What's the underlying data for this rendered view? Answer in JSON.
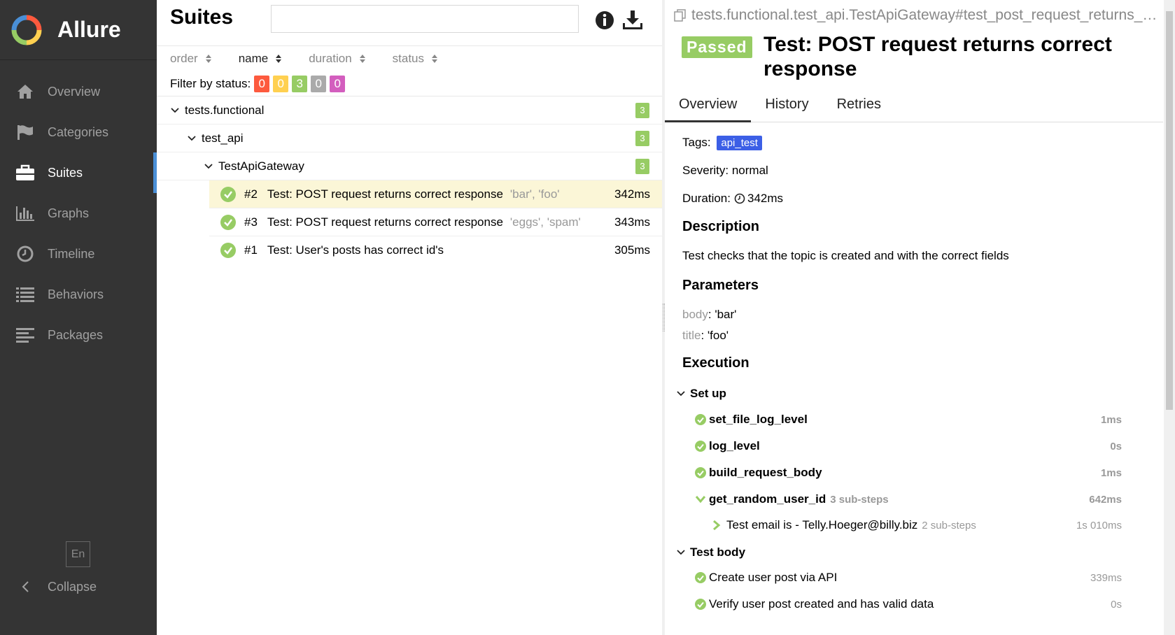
{
  "brand": {
    "name": "Allure"
  },
  "sidebar": {
    "items": [
      {
        "label": "Overview",
        "icon": "home-icon"
      },
      {
        "label": "Categories",
        "icon": "flag-icon"
      },
      {
        "label": "Suites",
        "icon": "briefcase-icon",
        "active": true
      },
      {
        "label": "Graphs",
        "icon": "bar-chart-icon"
      },
      {
        "label": "Timeline",
        "icon": "clock-icon"
      },
      {
        "label": "Behaviors",
        "icon": "list-icon"
      },
      {
        "label": "Packages",
        "icon": "align-left-icon"
      }
    ],
    "language": "En",
    "collapse_label": "Collapse"
  },
  "suites": {
    "title": "Suites",
    "search_placeholder": "",
    "sort": [
      {
        "label": "order"
      },
      {
        "label": "name",
        "active": true
      },
      {
        "label": "duration"
      },
      {
        "label": "status"
      }
    ],
    "filter_label": "Filter by status:",
    "status_counts": [
      {
        "value": "0",
        "color": "#fd5a3e",
        "status": "failed"
      },
      {
        "value": "0",
        "color": "#ffd050",
        "status": "broken"
      },
      {
        "value": "3",
        "color": "#97cc64",
        "status": "passed"
      },
      {
        "value": "0",
        "color": "#aaaaaa",
        "status": "skipped"
      },
      {
        "value": "0",
        "color": "#d35ebe",
        "status": "unknown"
      }
    ],
    "tree": [
      {
        "label": "tests.functional",
        "count": "3"
      },
      {
        "label": "test_api",
        "count": "3"
      },
      {
        "label": "TestApiGateway",
        "count": "3"
      }
    ],
    "tests": [
      {
        "num": "#2",
        "name": "Test: POST request returns correct response",
        "params": "'bar', 'foo'",
        "duration": "342ms",
        "selected": true
      },
      {
        "num": "#3",
        "name": "Test: POST request returns correct response",
        "params": "'eggs', 'spam'",
        "duration": "343ms"
      },
      {
        "num": "#1",
        "name": "Test: User's posts has correct id's",
        "params": "",
        "duration": "305ms"
      }
    ]
  },
  "detail": {
    "path": "tests.functional.test_api.TestApiGateway#test_post_request_returns_correct_response",
    "status": "Passed",
    "title": "Test: POST request returns correct response",
    "tabs": [
      "Overview",
      "History",
      "Retries"
    ],
    "tags_label": "Tags:",
    "tag": "api_test",
    "severity": "Severity: normal",
    "duration_label": "Duration:",
    "duration": "342ms",
    "description_title": "Description",
    "description": "Test checks that the topic is created and with the correct fields",
    "parameters_title": "Parameters",
    "parameters": [
      {
        "name": "body",
        "value": "'bar'"
      },
      {
        "name": "title",
        "value": "'foo'"
      }
    ],
    "execution_title": "Execution",
    "setup_label": "Set up",
    "setup_steps": [
      {
        "name": "set_file_log_level",
        "duration": "1ms"
      },
      {
        "name": "log_level",
        "duration": "0s"
      },
      {
        "name": "build_request_body",
        "duration": "1ms"
      },
      {
        "name": "get_random_user_id",
        "substeps": "3 sub-steps",
        "duration": "642ms"
      }
    ],
    "nested_step": {
      "name": "Test email is - Telly.Hoeger@billy.biz",
      "substeps": "2 sub-steps",
      "duration": "1s 010ms"
    },
    "body_label": "Test body",
    "body_steps": [
      {
        "name": "Create user post via API",
        "duration": "339ms"
      },
      {
        "name": "Verify user post created and has valid data",
        "duration": "0s"
      }
    ]
  }
}
